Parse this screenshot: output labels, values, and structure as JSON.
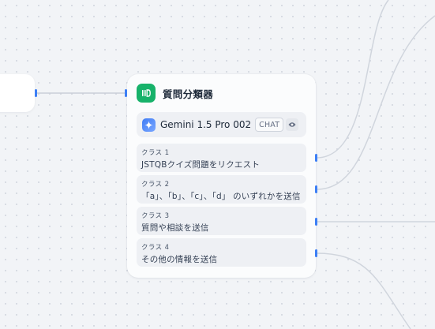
{
  "node": {
    "title": "質問分類器",
    "model": {
      "name": "Gemini 1.5 Pro 002",
      "badge": "CHAT",
      "icon": "gemini-sparkle-icon"
    },
    "classes": [
      {
        "label": "クラス 1",
        "text": "JSTQBクイズ問題をリクエスト"
      },
      {
        "label": "クラス 2",
        "text": "「a」、「b」、「c」、「d」 のいずれかを送信"
      },
      {
        "label": "クラス 3",
        "text": "質問や相談を送信"
      },
      {
        "label": "クラス 4",
        "text": "その他の情報を送信"
      }
    ]
  },
  "colors": {
    "accent": "#3d7ff5",
    "node_icon_bg": "#17b26a",
    "edge": "#d0d5dd",
    "canvas_bg": "#f2f4f7"
  }
}
